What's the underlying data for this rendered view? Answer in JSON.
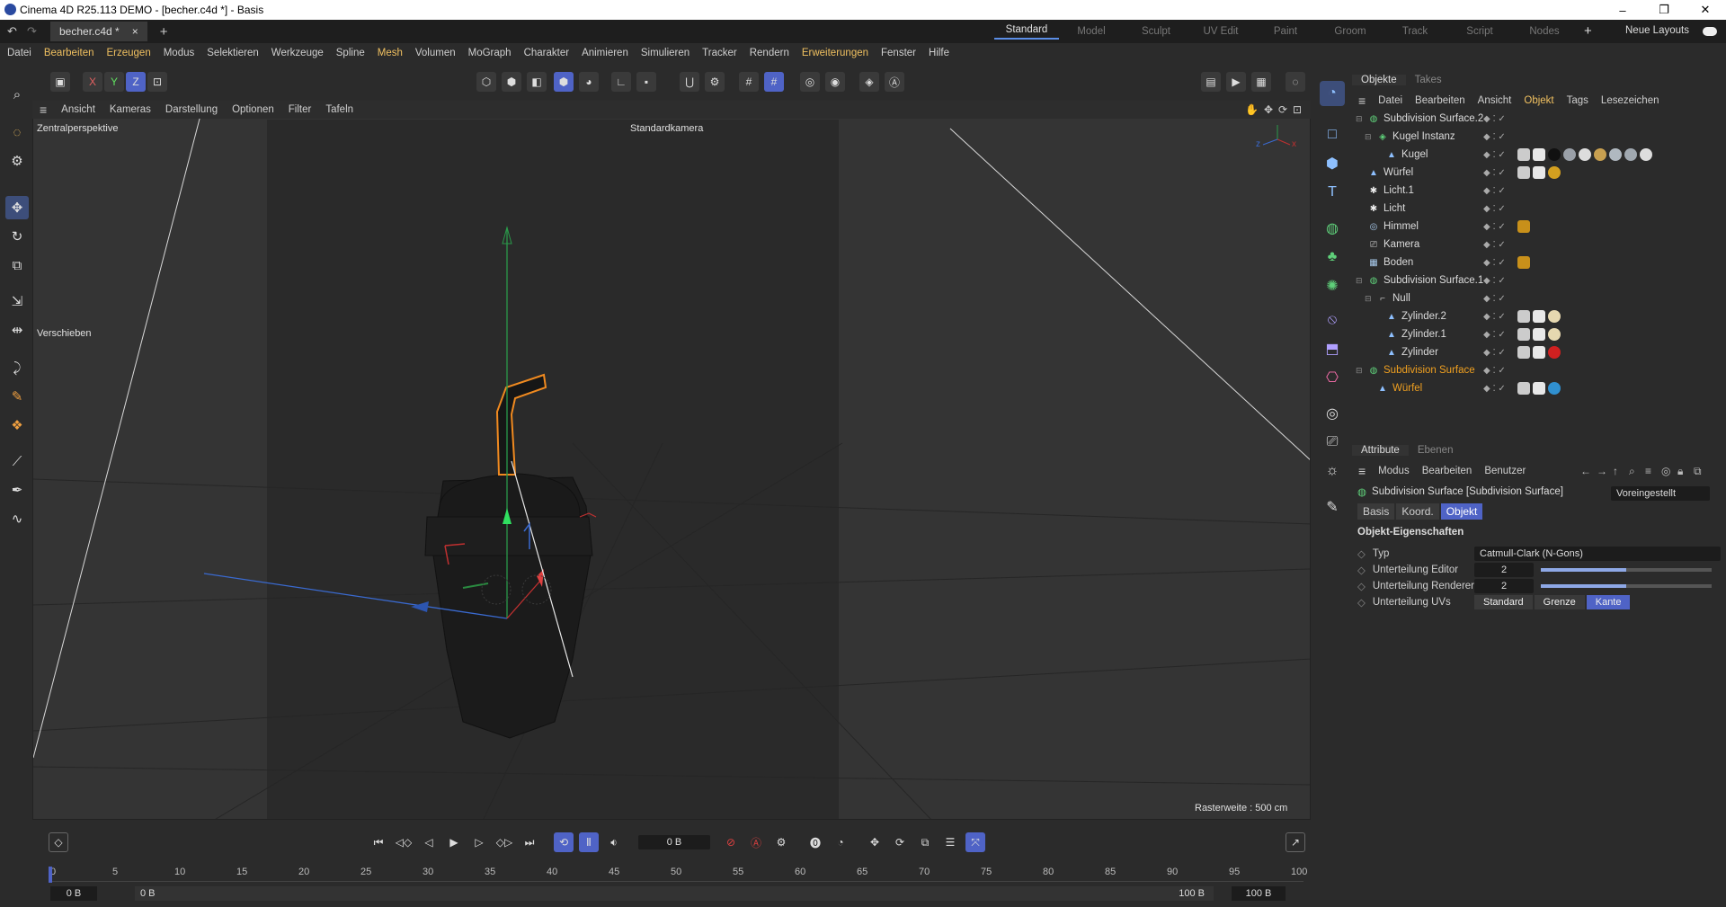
{
  "window": {
    "title": "Cinema 4D R25.113 DEMO - [becher.c4d *] - Basis",
    "controls": [
      "–",
      "❐",
      "✕"
    ]
  },
  "tabs": {
    "doc_tab": "becher.c4d *",
    "close": "×",
    "add": "+"
  },
  "layouts": {
    "items": [
      "Standard",
      "Model",
      "Sculpt",
      "UV Edit",
      "Paint",
      "Groom",
      "Track",
      "Script",
      "Nodes"
    ],
    "add": "+",
    "neue": "Neue Layouts"
  },
  "menu": [
    "Datei",
    "Bearbeiten",
    "Erzeugen",
    "Modus",
    "Selektieren",
    "Werkzeuge",
    "Spline",
    "Mesh",
    "Volumen",
    "MoGraph",
    "Charakter",
    "Animieren",
    "Simulieren",
    "Tracker",
    "Rendern",
    "Erweiterungen",
    "Fenster",
    "Hilfe"
  ],
  "axis_buttons": [
    "X",
    "Y",
    "Z"
  ],
  "viewport": {
    "menu": [
      "Ansicht",
      "Kameras",
      "Darstellung",
      "Optionen",
      "Filter",
      "Tafeln"
    ],
    "label": "Zentralperspektive",
    "camera": "Standardkamera",
    "tool": "Verschieben",
    "grid": "Rasterweite : 500 cm",
    "axis_x": "x",
    "axis_y": "y",
    "axis_z": "z"
  },
  "objects": {
    "tabs": [
      "Objekte",
      "Takes"
    ],
    "menu": [
      "Datei",
      "Bearbeiten",
      "Ansicht",
      "Objekt",
      "Tags",
      "Lesezeichen"
    ],
    "rows": [
      {
        "name": "Subdivision Surface.2",
        "indent": 0,
        "icon": "subdivision-icon",
        "color": "#5fd07a",
        "tags": []
      },
      {
        "name": "Kugel Instanz",
        "indent": 1,
        "icon": "instance-icon",
        "color": "#5fd07a",
        "tags": []
      },
      {
        "name": "Kugel",
        "indent": 2,
        "icon": "polygon-icon",
        "color": "#8ec0ff",
        "tags": [
          "#cccccc",
          "#e8e8e8",
          "#111111",
          "#9aa0a8",
          "#dddddd",
          "#c8a050",
          "#b0b8c0",
          "#a0a8b0",
          "#dddddd"
        ]
      },
      {
        "name": "Würfel",
        "indent": 0,
        "icon": "polygon-icon",
        "color": "#8ec0ff",
        "tags": [
          "#cccccc",
          "#e8e8e8",
          "#d4a020"
        ]
      },
      {
        "name": "Licht.1",
        "indent": 0,
        "icon": "light-icon",
        "color": "#eeeeee",
        "tags": []
      },
      {
        "name": "Licht",
        "indent": 0,
        "icon": "light-icon",
        "color": "#eeeeee",
        "tags": []
      },
      {
        "name": "Himmel",
        "indent": 0,
        "icon": "sky-icon",
        "color": "#aaccee",
        "tags": [
          "#c8901a"
        ]
      },
      {
        "name": "Kamera",
        "indent": 0,
        "icon": "camera-icon",
        "color": "#cccccc",
        "tags": []
      },
      {
        "name": "Boden",
        "indent": 0,
        "icon": "floor-icon",
        "color": "#aaccee",
        "tags": [
          "#c8901a"
        ]
      },
      {
        "name": "Subdivision Surface.1",
        "indent": 0,
        "icon": "subdivision-icon",
        "color": "#5fd07a",
        "tags": []
      },
      {
        "name": "Null",
        "indent": 1,
        "icon": "null-icon",
        "color": "#cccccc",
        "tags": []
      },
      {
        "name": "Zylinder.2",
        "indent": 2,
        "icon": "polygon-icon",
        "color": "#8ec0ff",
        "tags": [
          "#cccccc",
          "#e8e8e8",
          "#e6d8b0"
        ]
      },
      {
        "name": "Zylinder.1",
        "indent": 2,
        "icon": "polygon-icon",
        "color": "#8ec0ff",
        "tags": [
          "#cccccc",
          "#e8e8e8",
          "#e6d8b0"
        ]
      },
      {
        "name": "Zylinder",
        "indent": 2,
        "icon": "polygon-icon",
        "color": "#8ec0ff",
        "tags": [
          "#cccccc",
          "#e8e8e8",
          "#d02020"
        ]
      },
      {
        "name": "Subdivision Surface",
        "indent": 0,
        "icon": "subdivision-icon",
        "color": "#5fd07a",
        "tags": [],
        "selected": true
      },
      {
        "name": "Würfel",
        "indent": 1,
        "icon": "polygon-icon",
        "color": "#8ec0ff",
        "tags": [
          "#cccccc",
          "#e8e8e8",
          "#3090d0"
        ],
        "selected": true
      }
    ]
  },
  "attributes": {
    "tabs": [
      "Attribute",
      "Ebenen"
    ],
    "menu": [
      "Modus",
      "Bearbeiten",
      "Benutzer"
    ],
    "object_title": "Subdivision Surface [Subdivision Surface]",
    "preset": "Voreingestellt",
    "subtabs": [
      "Basis",
      "Koord.",
      "Objekt"
    ],
    "section": "Objekt-Eigenschaften",
    "typ_label": "Typ",
    "typ_value": "Catmull-Clark (N-Gons)",
    "editor_label": "Unterteilung Editor",
    "editor_value": "2",
    "editor_slider": 0.5,
    "renderer_label": "Unterteilung Renderer",
    "renderer_value": "2",
    "renderer_slider": 0.5,
    "uvs_label": "Unterteilung UVs",
    "uvs_options": [
      "Standard",
      "Grenze",
      "Kante"
    ],
    "uvs_selected": "Kante"
  },
  "timeline": {
    "current_frame": "0 B",
    "ticks": [
      "0",
      "5",
      "10",
      "15",
      "20",
      "25",
      "30",
      "35",
      "40",
      "45",
      "50",
      "55",
      "60",
      "65",
      "70",
      "75",
      "80",
      "85",
      "90",
      "95",
      "100"
    ],
    "start": "0 B",
    "start2": "0 B",
    "end": "100 B",
    "end2": "100 B"
  }
}
